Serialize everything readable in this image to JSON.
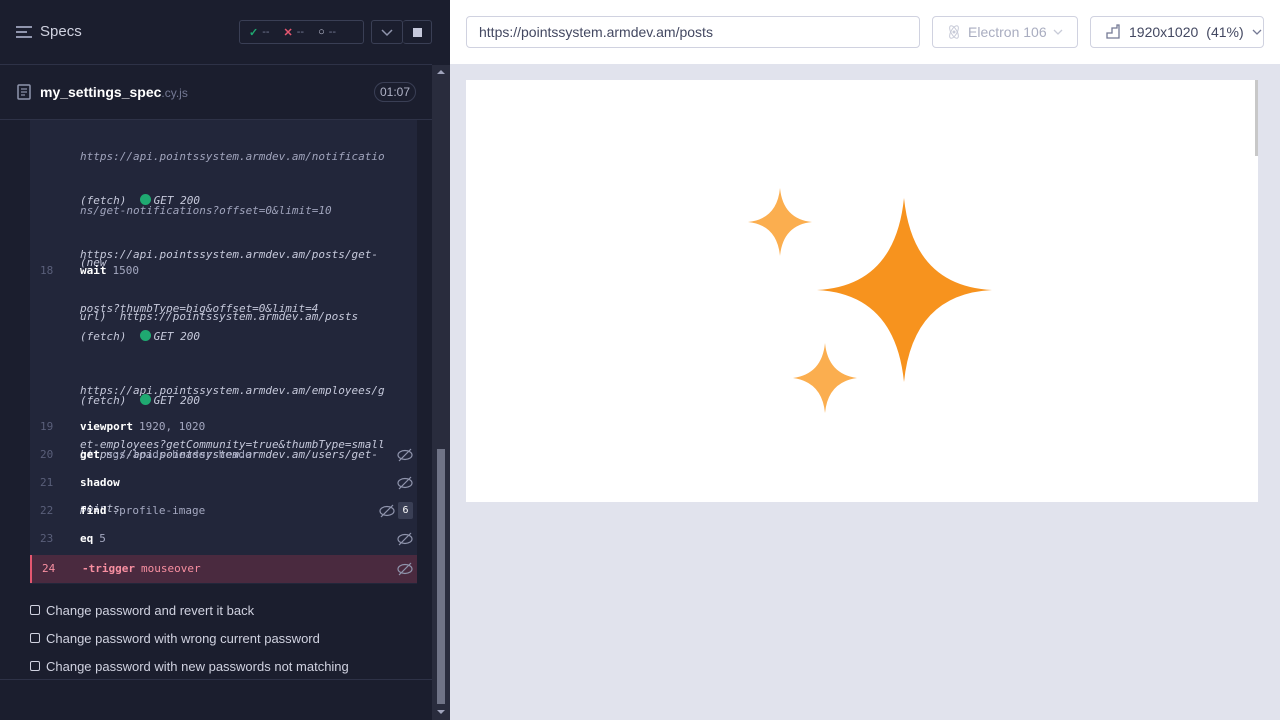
{
  "runner": {
    "specs_label": "Specs",
    "stats": {
      "passed": "--",
      "failed": "--",
      "pending": "--"
    },
    "spec": {
      "name": "my_settings_spec",
      "ext": ".cy.js",
      "duration": "01:07"
    },
    "log_requests": [
      {
        "lines": [
          "https://api.pointssystem.armdev.am/notificatio",
          "ns/get-notifications?offset=0&limit=10"
        ],
        "partial": true
      },
      {
        "prefix": "(fetch)",
        "method": "GET 200",
        "lines": [
          "https://api.pointssystem.armdev.am/posts/get-",
          "posts?thumbType=big&offset=0&limit=4"
        ]
      },
      {
        "prefix": "(new",
        "lines": [
          "url)  https://pointssystem.armdev.am/posts"
        ]
      }
    ],
    "log_requests_2": [
      {
        "prefix": "(fetch)",
        "method": "GET 200",
        "lines": [
          "https://api.pointssystem.armdev.am/employees/g",
          "et-employees?getCommunity=true&thumbType=small"
        ]
      },
      {
        "prefix": "(fetch)",
        "method": "GET 200",
        "lines": [
          "https://api.pointssystem.armdev.am/users/get-",
          "points"
        ]
      }
    ],
    "commands": [
      {
        "num": "18",
        "name": "wait",
        "arg": "1500"
      },
      {
        "num": "19",
        "name": "viewport",
        "arg": "1920, 1020"
      },
      {
        "num": "20",
        "name": "get",
        "arg": "ngs-loads-header-header"
      },
      {
        "num": "21",
        "name": "shadow",
        "arg": ""
      },
      {
        "num": "22",
        "name": "find",
        "arg": ".profile-image",
        "count": "6"
      },
      {
        "num": "23",
        "name": "eq",
        "arg": "5"
      },
      {
        "num": "24",
        "name": "-trigger",
        "arg": "mouseover"
      }
    ],
    "tests": [
      "Change password and revert it back",
      "Change password with wrong current password",
      "Change password with new passwords not matching"
    ]
  },
  "browser": {
    "url": "https://pointssystem.armdev.am/posts",
    "name": "Electron 106",
    "viewport": "1920x1020",
    "scale": "(41%)"
  },
  "colors": {
    "sparkle_main": "#f7931e",
    "sparkle_light": "#fbae4f"
  }
}
